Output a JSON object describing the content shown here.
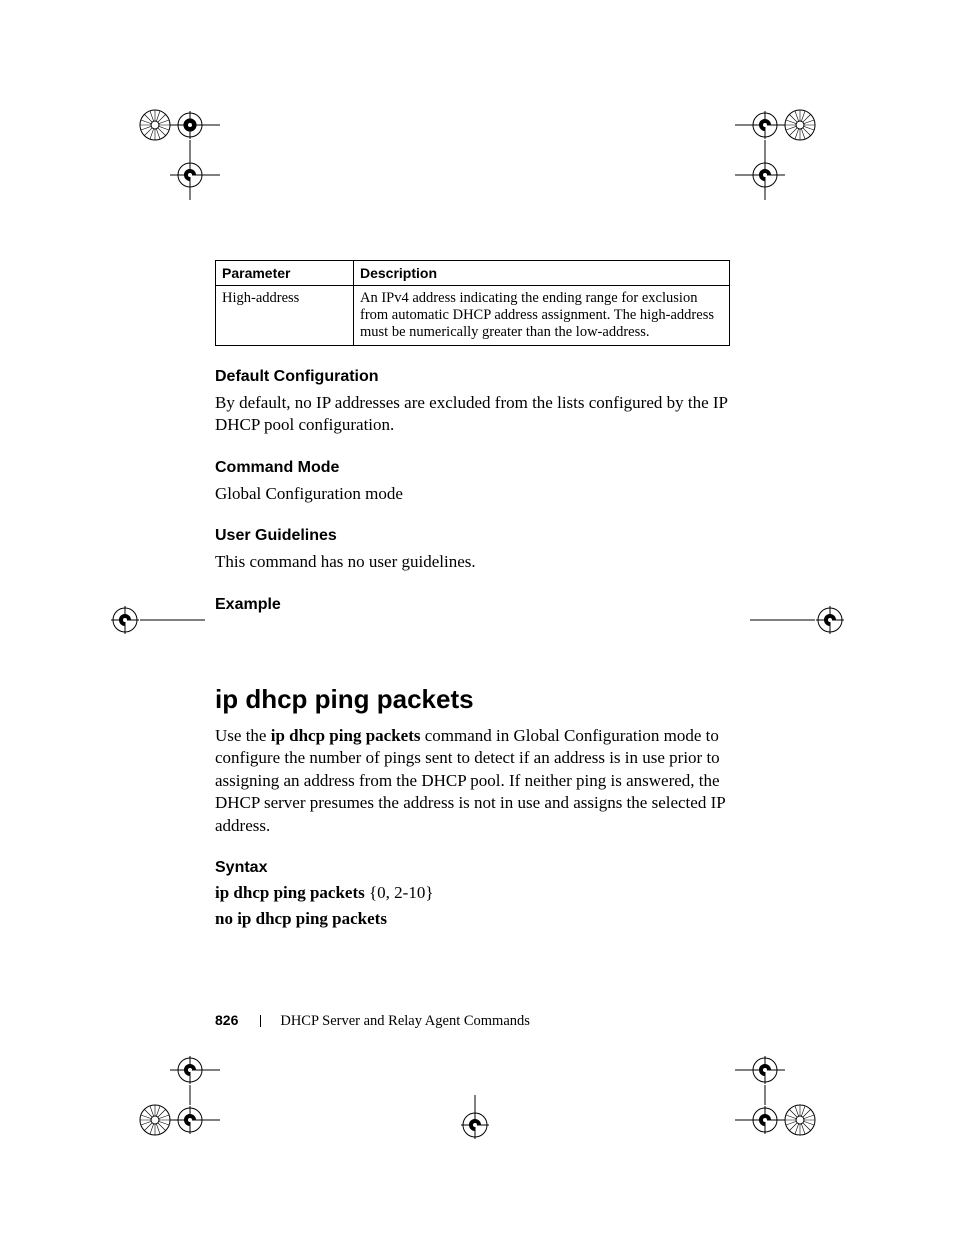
{
  "table": {
    "headers": {
      "param": "Parameter",
      "desc": "Description"
    },
    "row": {
      "param": "High-address",
      "desc": "An IPv4 address indicating the ending range for exclusion from automatic DHCP address assignment. The high-address must be numerically greater than the low-address."
    }
  },
  "sections": {
    "default_cfg": {
      "title": "Default Configuration",
      "body": "By default, no IP addresses are excluded from the lists configured by the IP DHCP pool configuration."
    },
    "cmd_mode": {
      "title": "Command Mode",
      "body": "Global Configuration mode"
    },
    "user_guidelines": {
      "title": "User Guidelines",
      "body": "This command has no user guidelines."
    },
    "example": {
      "title": "Example"
    }
  },
  "command": {
    "title": "ip dhcp ping packets",
    "intro_pre": "Use the ",
    "intro_bold": "ip dhcp ping packets",
    "intro_post": " command in Global Configuration mode to configure the number of pings sent to detect if an address is in use prior to assigning an address from the DHCP pool. If neither ping is answered, the DHCP server presumes the address is not in use and assigns the selected IP address.",
    "syntax": {
      "title": "Syntax",
      "line1_bold": "ip dhcp ping packets",
      "line1_rest": " {0, 2-10}",
      "line2_bold": "no ip dhcp ping packets"
    }
  },
  "footer": {
    "page": "826",
    "chapter": "DHCP Server and Relay Agent Commands"
  }
}
